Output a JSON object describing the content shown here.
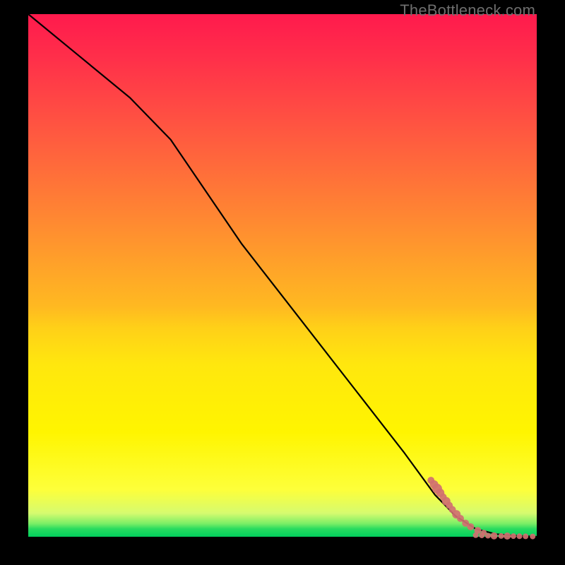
{
  "watermark": "TheBottleneck.com",
  "colors": {
    "gradient_top": "#ff1a4d",
    "gradient_mid": "#ffd018",
    "gradient_bottom": "#02cf5e",
    "curve": "#000000",
    "dots": "#d07070",
    "frame": "#000000"
  },
  "chart_data": {
    "type": "line",
    "title": "",
    "xlabel": "",
    "ylabel": "",
    "xlim": [
      0,
      100
    ],
    "ylim": [
      0,
      100
    ],
    "legend": false,
    "grid": false,
    "series": [
      {
        "name": "curve",
        "x": [
          0,
          10,
          20,
          28,
          35,
          42,
          50,
          58,
          66,
          74,
          80,
          84,
          88,
          92,
          96,
          100
        ],
        "y": [
          100,
          92,
          84,
          76,
          66,
          56,
          46,
          36,
          26,
          16,
          8,
          4,
          1.5,
          0.5,
          0.2,
          0
        ]
      }
    ],
    "scatter": {
      "name": "dots",
      "comment": "Clustered points near bottom-right along the curve tail",
      "points": [
        {
          "x": 79.2,
          "y": 10.8,
          "r": 5
        },
        {
          "x": 79.8,
          "y": 10.0,
          "r": 6
        },
        {
          "x": 80.4,
          "y": 9.2,
          "r": 7
        },
        {
          "x": 81.0,
          "y": 8.4,
          "r": 6
        },
        {
          "x": 81.6,
          "y": 7.6,
          "r": 5
        },
        {
          "x": 82.2,
          "y": 6.8,
          "r": 6
        },
        {
          "x": 82.8,
          "y": 6.0,
          "r": 5
        },
        {
          "x": 83.4,
          "y": 5.2,
          "r": 5
        },
        {
          "x": 84.2,
          "y": 4.3,
          "r": 6
        },
        {
          "x": 85.0,
          "y": 3.5,
          "r": 5
        },
        {
          "x": 86.0,
          "y": 2.6,
          "r": 5
        },
        {
          "x": 87.0,
          "y": 1.9,
          "r": 5
        },
        {
          "x": 88.4,
          "y": 1.2,
          "r": 5
        },
        {
          "x": 89.6,
          "y": 0.8,
          "r": 4
        },
        {
          "x": 88.0,
          "y": 0.3,
          "r": 4
        },
        {
          "x": 89.2,
          "y": 0.25,
          "r": 4
        },
        {
          "x": 90.4,
          "y": 0.2,
          "r": 4
        },
        {
          "x": 91.6,
          "y": 0.18,
          "r": 5
        },
        {
          "x": 93.0,
          "y": 0.15,
          "r": 4
        },
        {
          "x": 94.2,
          "y": 0.14,
          "r": 5
        },
        {
          "x": 95.4,
          "y": 0.12,
          "r": 4
        },
        {
          "x": 96.6,
          "y": 0.1,
          "r": 4
        },
        {
          "x": 97.8,
          "y": 0.08,
          "r": 4
        },
        {
          "x": 99.2,
          "y": 0.06,
          "r": 4
        }
      ]
    }
  }
}
